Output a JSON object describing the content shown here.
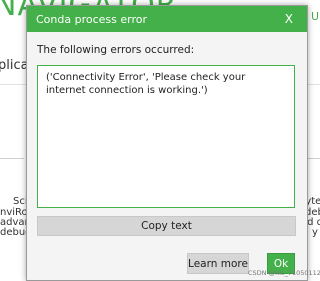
{
  "background_app": {
    "brand_fragment": "NAVIGATOR",
    "upgrade_fragment": "Up",
    "tab_fragment": "plicat",
    "left_col": [
      "Sci",
      "nviRo",
      "advan",
      "debug"
    ],
    "right_col": [
      "pyte",
      "debu",
      "ed de",
      "y"
    ]
  },
  "dialog": {
    "title": "Conda process error",
    "close_label": "X",
    "message": "The following errors occurred:",
    "error_text": "('Connectivity Error', 'Please check your internet connection is working.')",
    "copy_button": "Copy text",
    "learn_more_button": "Learn more",
    "ok_button": "Ok"
  },
  "watermark": "CSDN @nlc_71050112",
  "colors": {
    "accent_green": "#43b049",
    "dialog_bg": "#f4f4f4",
    "button_gray": "#d6d6d6"
  }
}
